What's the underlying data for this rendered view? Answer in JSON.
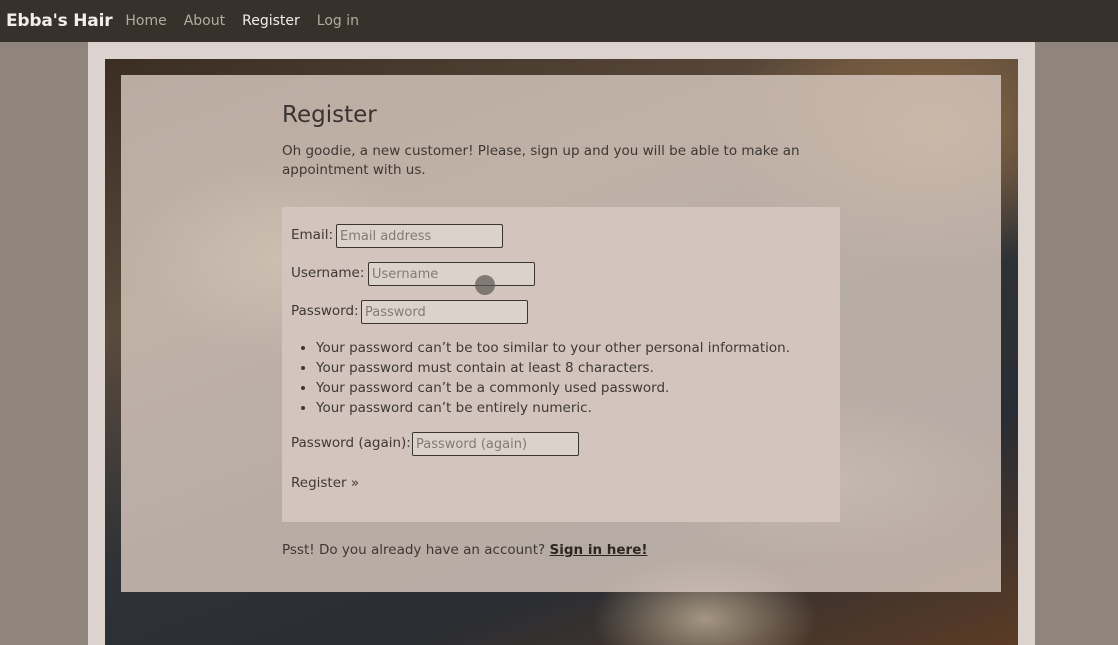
{
  "navbar": {
    "brand": "Ebba's Hair",
    "links": [
      {
        "label": "Home",
        "active": false
      },
      {
        "label": "About",
        "active": false
      },
      {
        "label": "Register",
        "active": true
      },
      {
        "label": "Log in",
        "active": false
      }
    ]
  },
  "page": {
    "title": "Register",
    "intro": "Oh goodie, a new customer! Please, sign up and you will be able to make an appointment with us."
  },
  "form": {
    "email": {
      "label": "Email:",
      "value": "",
      "placeholder": "Email address"
    },
    "username": {
      "label": "Username:",
      "value": "",
      "placeholder": "Username"
    },
    "password": {
      "label": "Password:",
      "value": "",
      "placeholder": "Password"
    },
    "password_hints": [
      "Your password can’t be too similar to your other personal information.",
      "Your password must contain at least 8 characters.",
      "Your password can’t be a commonly used password.",
      "Your password can’t be entirely numeric."
    ],
    "password2": {
      "label": "Password (again):",
      "value": "",
      "placeholder": "Password (again)"
    },
    "submit_label": "Register »"
  },
  "signin": {
    "prompt": "Psst! Do you already have an account?",
    "link_label": "Sign in here!"
  },
  "colors": {
    "navbar_bg": "#37312c",
    "panel_bg": "#d7c8be",
    "form_bg": "#d3c5bd",
    "text": "#3e3834"
  }
}
